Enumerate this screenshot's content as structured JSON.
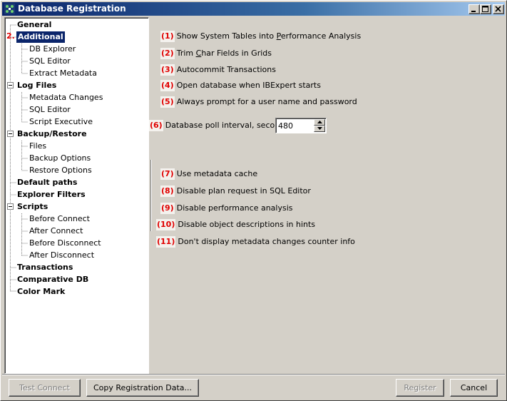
{
  "window": {
    "title": "Database Registration"
  },
  "tree": {
    "marker": "2.",
    "items": [
      {
        "label": "General",
        "level": 0
      },
      {
        "label": "Additional",
        "level": 0
      },
      {
        "label": "DB Explorer",
        "level": 1
      },
      {
        "label": "SQL Editor",
        "level": 1
      },
      {
        "label": "Extract Metadata",
        "level": 1
      },
      {
        "label": "Log Files",
        "level": 0
      },
      {
        "label": "Metadata Changes",
        "level": 1
      },
      {
        "label": "SQL Editor",
        "level": 1
      },
      {
        "label": "Script Executive",
        "level": 1
      },
      {
        "label": "Backup/Restore",
        "level": 0
      },
      {
        "label": "Files",
        "level": 1
      },
      {
        "label": "Backup Options",
        "level": 1
      },
      {
        "label": "Restore Options",
        "level": 1
      },
      {
        "label": "Default paths",
        "level": 0
      },
      {
        "label": "Explorer Filters",
        "level": 0
      },
      {
        "label": "Scripts",
        "level": 0
      },
      {
        "label": "Before Connect",
        "level": 1
      },
      {
        "label": "After Connect",
        "level": 1
      },
      {
        "label": "Before Disconnect",
        "level": 1
      },
      {
        "label": "After Disconnect",
        "level": 1
      },
      {
        "label": "Transactions",
        "level": 0
      },
      {
        "label": "Comparative DB",
        "level": 0
      },
      {
        "label": "Color Mark",
        "level": 0
      }
    ]
  },
  "options": [
    {
      "num": "(1)",
      "label_pre": "Show System Tables into ",
      "label_u": "P",
      "label_post": "erformance Analysis"
    },
    {
      "num": "(2)",
      "label_pre": "Trim ",
      "label_u": "C",
      "label_post": "har Fields in Grids"
    },
    {
      "num": "(3)",
      "label_pre": "Autocommit Transactions",
      "label_u": "",
      "label_post": ""
    },
    {
      "num": "(4)",
      "label_pre": "Open database when IBExpert starts",
      "label_u": "",
      "label_post": ""
    },
    {
      "num": "(5)",
      "label_pre": "Always prompt for a user name and password",
      "label_u": "",
      "label_post": ""
    },
    {
      "num": "(6)",
      "label_pre": "Database poll interval, seconds",
      "label_u": "",
      "label_post": ""
    },
    {
      "num": "(7)",
      "label_pre": "Use metadata cache",
      "label_u": "",
      "label_post": ""
    },
    {
      "num": "(8)",
      "label_pre": "Disable plan request in SQL Editor",
      "label_u": "",
      "label_post": ""
    },
    {
      "num": "(9)",
      "label_pre": "Disable performance analysis",
      "label_u": "",
      "label_post": ""
    },
    {
      "num": "(10)",
      "label_pre": "Disable object descriptions in hints",
      "label_u": "",
      "label_post": ""
    },
    {
      "num": "(11)",
      "label_pre": "Don't display metadata changes counter info",
      "label_u": "",
      "label_post": ""
    }
  ],
  "poll_interval": {
    "value": "480"
  },
  "buttons": {
    "test_connect": "Test Connect",
    "copy_registration": "Copy Registration Data...",
    "register": "Register",
    "cancel": "Cancel"
  },
  "colors": {
    "title_start": "#0a246a",
    "title_end": "#a6caf0",
    "selection": "#0a246a",
    "marker_red": "#e00000",
    "face": "#d4d0c8"
  },
  "icons": {
    "app": "database-app-icon",
    "minimize": "minimize-icon",
    "maximize": "maximize-icon",
    "close": "close-icon"
  }
}
